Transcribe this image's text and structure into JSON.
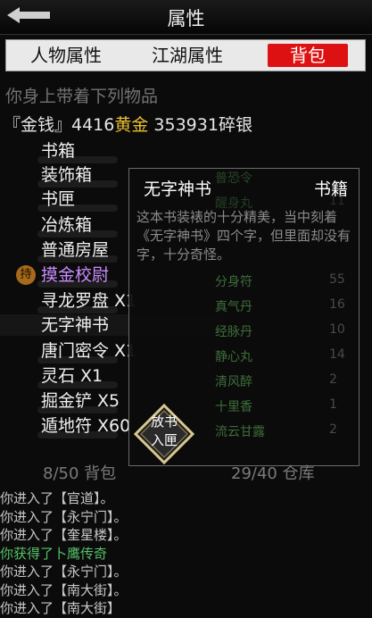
{
  "header": {
    "title": "属性"
  },
  "tabs": [
    {
      "label": "人物属性"
    },
    {
      "label": "江湖属性"
    },
    {
      "label": "背包",
      "active": true
    }
  ],
  "inventory": {
    "carry_text": "你身上带着下列物品",
    "money": {
      "prefix": "『金钱』4416",
      "gold_label": "黄金",
      "silver": " 353931碎银"
    },
    "items": [
      {
        "label": "书箱"
      },
      {
        "label": "装饰箱"
      },
      {
        "label": "书匣"
      },
      {
        "label": "冶炼箱"
      },
      {
        "label": "普通房屋"
      },
      {
        "label": "摸金校尉",
        "badge": "持",
        "color": "#c98cff"
      },
      {
        "label": "寻龙罗盘 X1"
      },
      {
        "label": "无字神书",
        "selected": true
      },
      {
        "label": "唐门密令 X1"
      },
      {
        "label": "灵石 X1"
      },
      {
        "label": "掘金铲 X5"
      },
      {
        "label": "遁地符 X60"
      }
    ],
    "bag_count": "8/50 背包",
    "warehouse_count": "29/40 仓库"
  },
  "popup": {
    "title": "无字神书",
    "type": "书籍",
    "description": "这本书装裱的十分精美，当中刻着《无字神书》四个字，但里面却没有字，十分奇怪。",
    "action_label_line1": "放书",
    "action_label_line2": "入匣",
    "background_items": [
      {
        "name": "普恐令",
        "count": ""
      },
      {
        "name": "醒身丸",
        "count": "11"
      },
      {
        "name": "分身符",
        "count": "55"
      },
      {
        "name": "真气丹",
        "count": "16"
      },
      {
        "name": "经脉丹",
        "count": "10"
      },
      {
        "name": "静心丸",
        "count": "14"
      },
      {
        "name": "清风醉",
        "count": "2"
      },
      {
        "name": "十里香",
        "count": "1"
      },
      {
        "name": "流云甘露",
        "count": "2"
      }
    ]
  },
  "log": [
    {
      "text": "你进入了【官道】。"
    },
    {
      "text": "你进入了【永宁门】。"
    },
    {
      "text": "你进入了【奎星楼】。"
    },
    {
      "text": "你获得了卜鹰传奇",
      "color": "green"
    },
    {
      "text": "你进入了【永宁门】。"
    },
    {
      "text": "你进入了【南大街】。"
    },
    {
      "text": "你进入了【南大街】"
    }
  ],
  "colors": {
    "accent": "#dd1111",
    "gold": "#e8c030",
    "log_highlight": "#57c26a",
    "special_item": "#c98cff"
  }
}
